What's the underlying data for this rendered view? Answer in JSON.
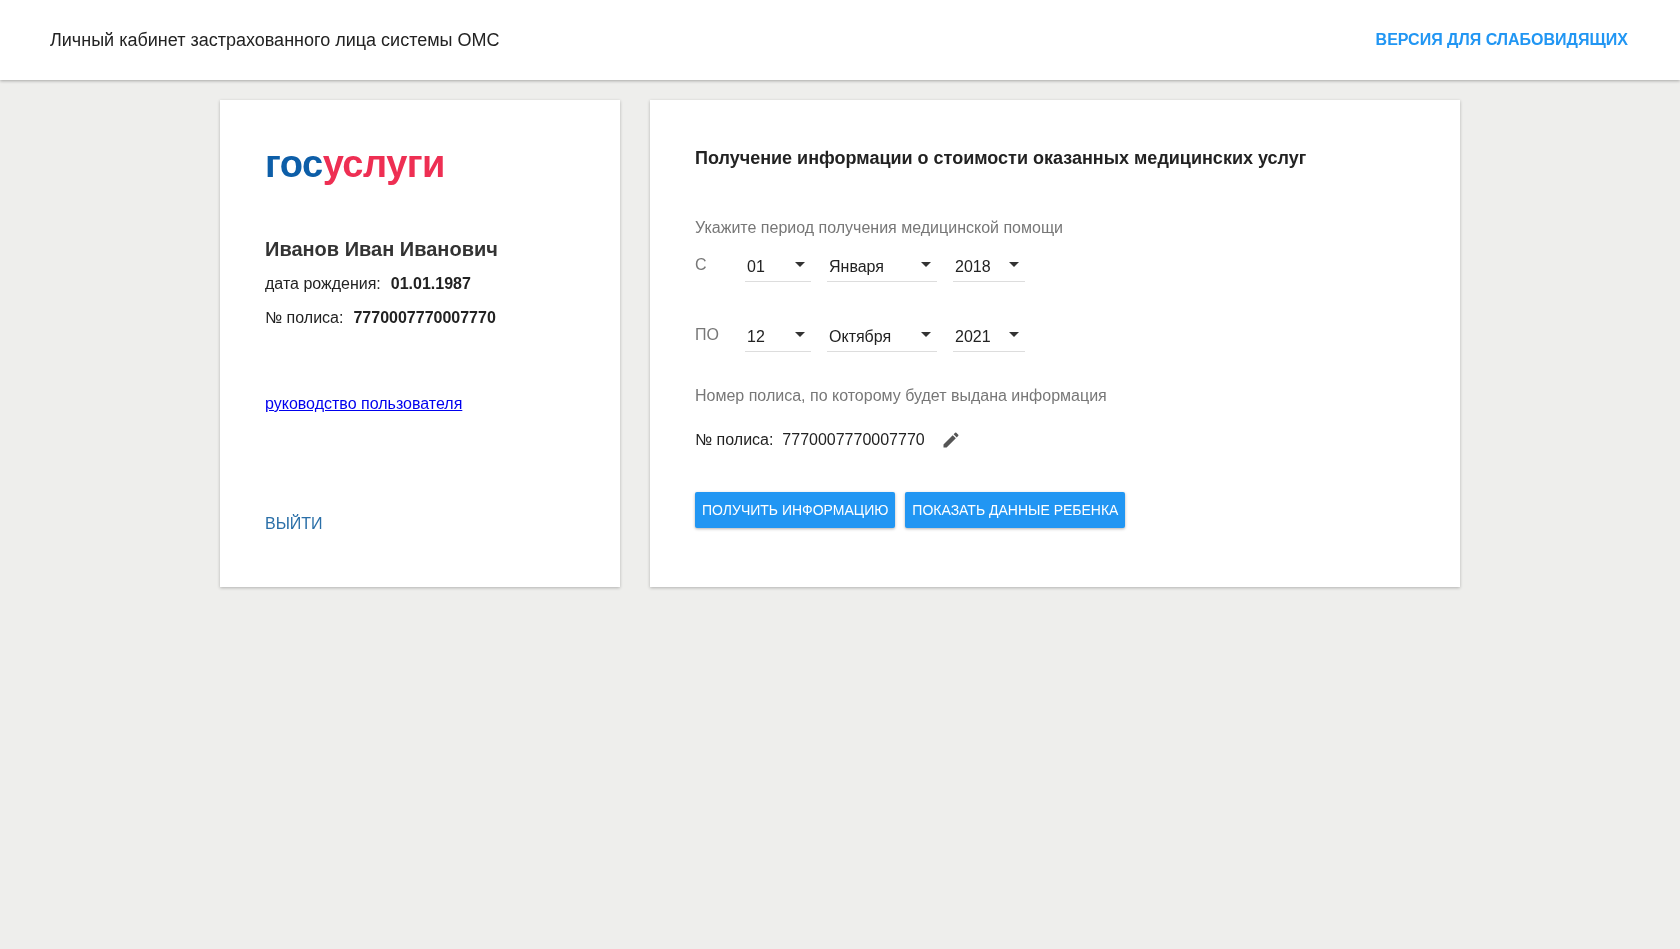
{
  "header": {
    "title": "Личный кабинет застрахованного лица системы ОМС",
    "accessibility_link": "ВЕРСИЯ ДЛЯ СЛАБОВИДЯЩИХ"
  },
  "profile": {
    "logo": [
      {
        "text": "гос",
        "color": "#0d5ea8"
      },
      {
        "text": "услуги",
        "color": "#ee2f53"
      }
    ],
    "name": "Иванов Иван Иванович",
    "fields": [
      {
        "label": "дата рождения:",
        "value": "01.01.1987"
      },
      {
        "label": "№ полиса:",
        "value": "7770007770007770"
      }
    ],
    "guide_link": "руководство пользователя",
    "logout": "ВЫЙТИ"
  },
  "form": {
    "title": "Получение информации о стоимости оказанных медицинских услуг",
    "period_label": "Укажите период получения медицинской помощи",
    "period": [
      {
        "label": "С",
        "day": "01",
        "month": "Января",
        "year": "2018"
      },
      {
        "label": "ПО",
        "day": "12",
        "month": "Октября",
        "year": "2021"
      }
    ],
    "policy_label": "Номер полиса, по которому будет выдана информация",
    "policy": {
      "label": "№ полиса:",
      "value": "7770007770007770"
    },
    "buttons": [
      "ПОЛУЧИТЬ ИНФОРМАЦИЮ",
      "ПОКАЗАТЬ ДАННЫЕ РЕБЕНКА"
    ]
  }
}
